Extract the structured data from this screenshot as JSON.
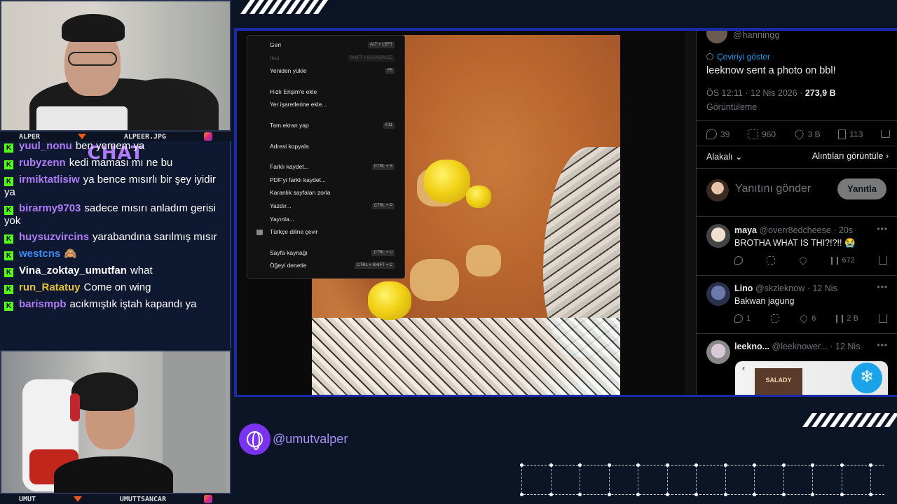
{
  "cams": {
    "top": {
      "left_label": "ALPER",
      "right_label": "ALPEER.JPG"
    },
    "bottom": {
      "left_label": "UMUT",
      "right_label": "UMUTTSANCAR"
    }
  },
  "chat": {
    "title": "CHAT",
    "messages": [
      {
        "user": "yuul_nonu",
        "text": "ben yemem ya",
        "color": "#b07cf7"
      },
      {
        "user": "rubyzenn",
        "text": "kedi maması mı ne bu",
        "color": "#b07cf7"
      },
      {
        "user": "irmiktatlisiw",
        "text": "ya bence mısırlı bir şey iyidir ya",
        "color": "#b07cf7"
      },
      {
        "user": "birarmy9703",
        "text": "sadece mısırı anladım gerisi yok",
        "color": "#b07cf7"
      },
      {
        "user": "huysuzvircins",
        "text": "yarabandına sarılmış mısır",
        "color": "#b07cf7"
      },
      {
        "user": "westcns",
        "text": "🙈",
        "color": "#3b8cf7"
      },
      {
        "user": "Vina_zoktay_umutfan",
        "text": "what",
        "color": "#ffffff"
      },
      {
        "user": "run_Ratatuy",
        "text": "Come on wing",
        "color": "#e8c23a"
      },
      {
        "user": "barismpb",
        "text": "acıkmıştık iştah kapandı ya",
        "color": "#b07cf7"
      }
    ]
  },
  "context_menu": {
    "items": [
      {
        "label": "Geri",
        "shortcut": "ALT + LEFT",
        "disabled": false
      },
      {
        "label": "İleri",
        "shortcut": "SHIFT + BACKSPACE",
        "disabled": true
      },
      {
        "label": "Yeniden yükle",
        "shortcut": "F5",
        "disabled": false
      },
      {
        "sep": true
      },
      {
        "label": "Hızlı Erişim'e ekle",
        "shortcut": "",
        "disabled": false
      },
      {
        "label": "Yer işaretlerine ekle...",
        "shortcut": "",
        "disabled": false
      },
      {
        "sep": true
      },
      {
        "label": "Tam ekran yap",
        "shortcut": "F11",
        "disabled": false
      },
      {
        "sep": true
      },
      {
        "label": "Adresi kopyala",
        "shortcut": "",
        "disabled": false
      },
      {
        "sep": true
      },
      {
        "label": "Farklı kaydet...",
        "shortcut": "CTRL + S",
        "disabled": false
      },
      {
        "label": "PDF'yi farklı kaydet...",
        "shortcut": "",
        "disabled": false
      },
      {
        "label": "Karanlık sayfaları zorla",
        "shortcut": "",
        "disabled": false
      },
      {
        "label": "Yazdır...",
        "shortcut": "CTRL + P",
        "disabled": false
      },
      {
        "label": "Yayınla...",
        "shortcut": "",
        "disabled": false
      },
      {
        "label": "Türkçe diline çevir",
        "shortcut": "",
        "disabled": false,
        "icon": "translate-icon"
      },
      {
        "sep": true
      },
      {
        "label": "Sayfa kaynağı",
        "shortcut": "CTRL + U",
        "disabled": false
      },
      {
        "label": "Öğeyi denetle",
        "shortcut": "CTRL + SHIFT + C",
        "disabled": false
      }
    ]
  },
  "tweet": {
    "handle_top": "@hanningg",
    "translate": "Çeviriyi göster",
    "text": "leeknow sent a photo on bbl!",
    "time": "ÖS 12:11 · 12 Nis 2026 · ",
    "views_count": "273,9 B",
    "views_label": "Görüntüleme",
    "replies": "39",
    "retweets": "960",
    "likes": "3 B",
    "bookmarks": "113",
    "sort": "Alakalı",
    "quotes": "Alıntıları görüntüle",
    "reply_placeholder": "Yanıtını gönder",
    "reply_button": "Yanıtla"
  },
  "replies": [
    {
      "name": "maya",
      "handle": "@overr8edcheese · 20s",
      "text": "BROTHA WHAT IS THI?!?!! 😭",
      "r": "",
      "rt": "",
      "like": "",
      "views": "672"
    },
    {
      "name": "Lino",
      "handle": "@skzleknow · 12 Nis",
      "text": "Bakwan jagung",
      "r": "1",
      "rt": "",
      "like": "6",
      "views": "2 B"
    },
    {
      "name": "leekno...",
      "handle": "@leeknower... · 12 Nis",
      "text": "",
      "r": "",
      "rt": "",
      "like": "",
      "views": ""
    }
  ],
  "card": {
    "brand": "SALADY",
    "snow": "❄"
  },
  "overlay": {
    "handle": "@umutvalper"
  },
  "icons": [
    "instagram-icon",
    "kick-icon",
    "globe-icon",
    "translate-icon",
    "reply-icon",
    "retweet-icon",
    "like-icon",
    "bookmark-icon",
    "share-icon",
    "views-icon",
    "more-icon",
    "chevron-left-icon",
    "snowflake-icon"
  ]
}
